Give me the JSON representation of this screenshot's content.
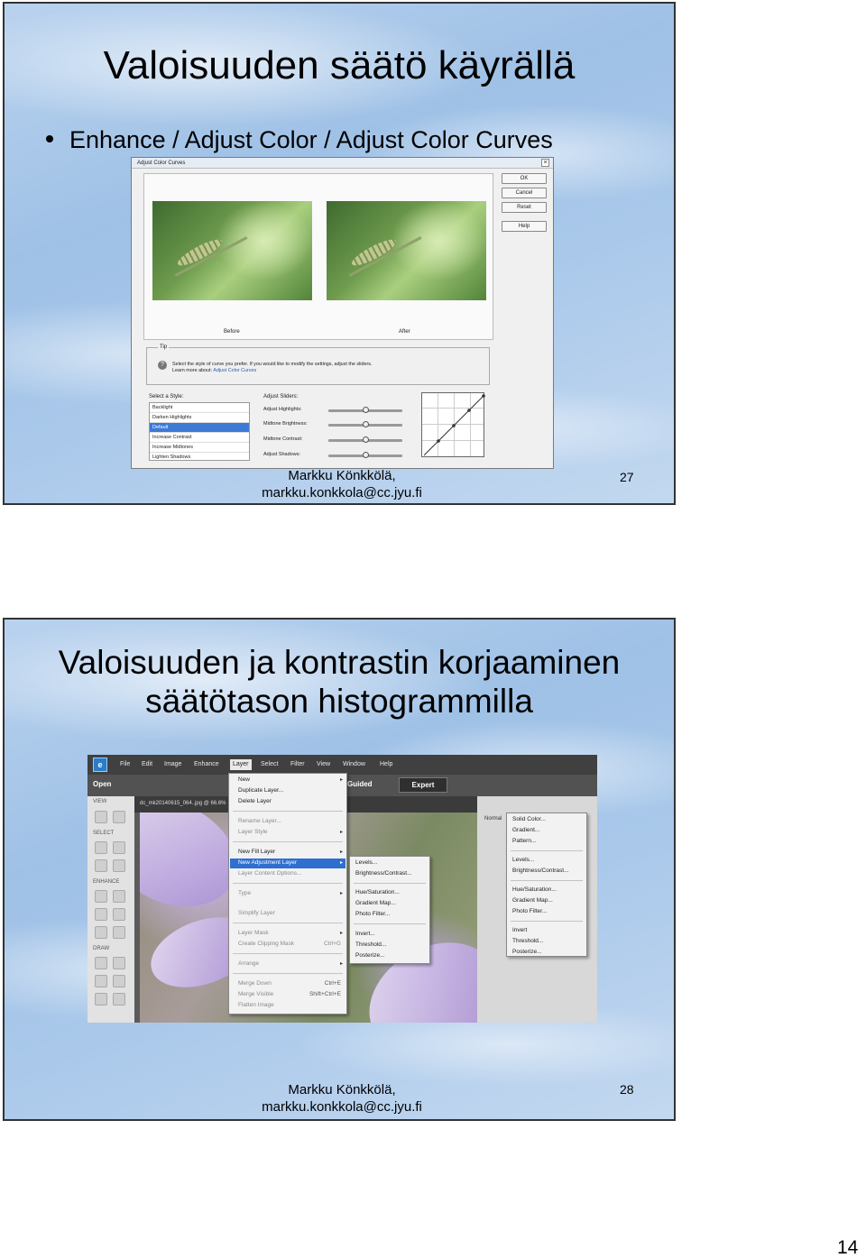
{
  "slide1": {
    "title": "Valoisuuden säätö käyrällä",
    "bullet": "Enhance / Adjust Color / Adjust Color Curves",
    "footer_name": "Markku Könkkölä,",
    "footer_email": "markku.konkkola@cc.jyu.fi",
    "slide_number": "27",
    "dialog": {
      "title": "Adjust Color Curves",
      "close": "×",
      "buttons": [
        "OK",
        "Cancel",
        "Reset",
        "Help"
      ],
      "before_label": "Before",
      "after_label": "After",
      "tip_heading": "Tip",
      "tip_icon": "?",
      "tip_text": "Select the style of curve you prefer. If you would like to modify the settings, adjust the sliders.",
      "tip_learn": "Learn more about: ",
      "tip_link": "Adjust Color Curves",
      "select_style_label": "Select a Style:",
      "styles": [
        "Backlight",
        "Darken Highlights",
        "Default",
        "Increase Contrast",
        "Increase Midtones",
        "Lighten Shadows"
      ],
      "selected_style_index": 2,
      "adjust_sliders_label": "Adjust Sliders:",
      "sliders": [
        "Adjust Highlights:",
        "Midtone Brightness:",
        "Midtone Contrast:",
        "Adjust Shadows:"
      ]
    }
  },
  "slide2": {
    "title_line1": "Valoisuuden ja kontrastin korjaaminen",
    "title_line2": "säätötason histogrammilla",
    "footer_name": "Markku Könkkölä,",
    "footer_email": "markku.konkkola@cc.jyu.fi",
    "slide_number": "28",
    "app": {
      "logo": "e",
      "menu": [
        "File",
        "Edit",
        "Image",
        "Enhance",
        "Layer",
        "Select",
        "Filter",
        "View",
        "Window",
        "Help"
      ],
      "active_menu": "Layer",
      "open_button": "Open",
      "mode_guided": "Guided",
      "mode_expert": "Expert",
      "tool_sections": [
        "VIEW",
        "SELECT",
        "ENHANCE",
        "DRAW"
      ],
      "document_tab": "dc_mk20140615_064..jpg @ 66.6%",
      "panel_label": "Normal",
      "layer_menu": [
        "New",
        "Duplicate Layer...",
        "Delete Layer",
        "Rename Layer...",
        "Layer Style",
        "New Fill Layer",
        "New Adjustment Layer",
        "Layer Content Options...",
        "Type",
        "Simplify Layer",
        "Layer Mask",
        "Create Clipping Mask",
        "Arrange",
        "Merge Down",
        "Merge Visible",
        "Flatten Image"
      ],
      "layer_menu_shortcuts": {
        "create_clipping_mask": "Ctrl+G",
        "merge_down": "Ctrl+E",
        "merge_visible": "Shift+Ctrl+E"
      },
      "adjustment_submenu": [
        "Levels...",
        "Brightness/Contrast...",
        "Hue/Saturation...",
        "Gradient Map...",
        "Photo Filter...",
        "Invert...",
        "Threshold...",
        "Posterize..."
      ],
      "panel_menu": [
        "Solid Color...",
        "Gradient...",
        "Pattern...",
        "Levels...",
        "Brightness/Contrast...",
        "Hue/Saturation...",
        "Gradient Map...",
        "Photo Filter...",
        "Invert",
        "Threshold...",
        "Posterize..."
      ]
    }
  },
  "page_number": "14"
}
